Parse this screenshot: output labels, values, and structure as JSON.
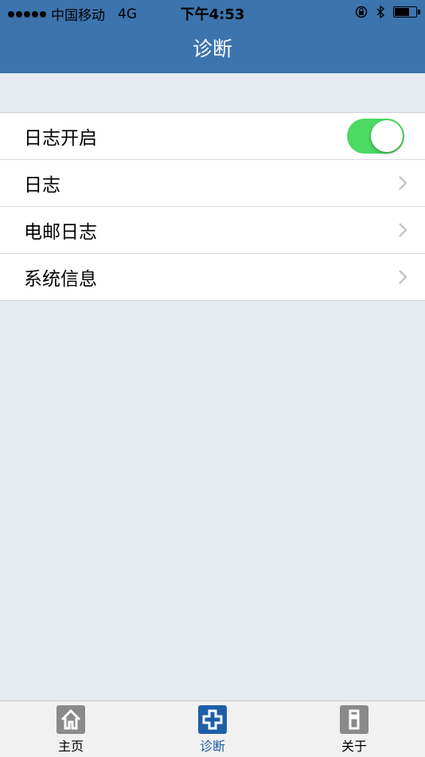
{
  "status_bar": {
    "carrier": "中国移动",
    "network": "4G",
    "time": "下午4:53"
  },
  "nav": {
    "title": "诊断"
  },
  "list": {
    "items": [
      {
        "label": "日志开启",
        "type": "toggle",
        "on": true
      },
      {
        "label": "日志",
        "type": "link"
      },
      {
        "label": "电邮日志",
        "type": "link"
      },
      {
        "label": "系统信息",
        "type": "link"
      }
    ]
  },
  "tabs": [
    {
      "label": "主页",
      "icon": "home-icon",
      "active": false
    },
    {
      "label": "诊断",
      "icon": "diagnose-icon",
      "active": true
    },
    {
      "label": "关于",
      "icon": "info-icon",
      "active": false
    }
  ],
  "colors": {
    "nav_blue": "#3c74ae",
    "toggle_green": "#4cd964",
    "tab_active": "#1e5ea6",
    "tab_inactive": "#8a8a8a"
  }
}
